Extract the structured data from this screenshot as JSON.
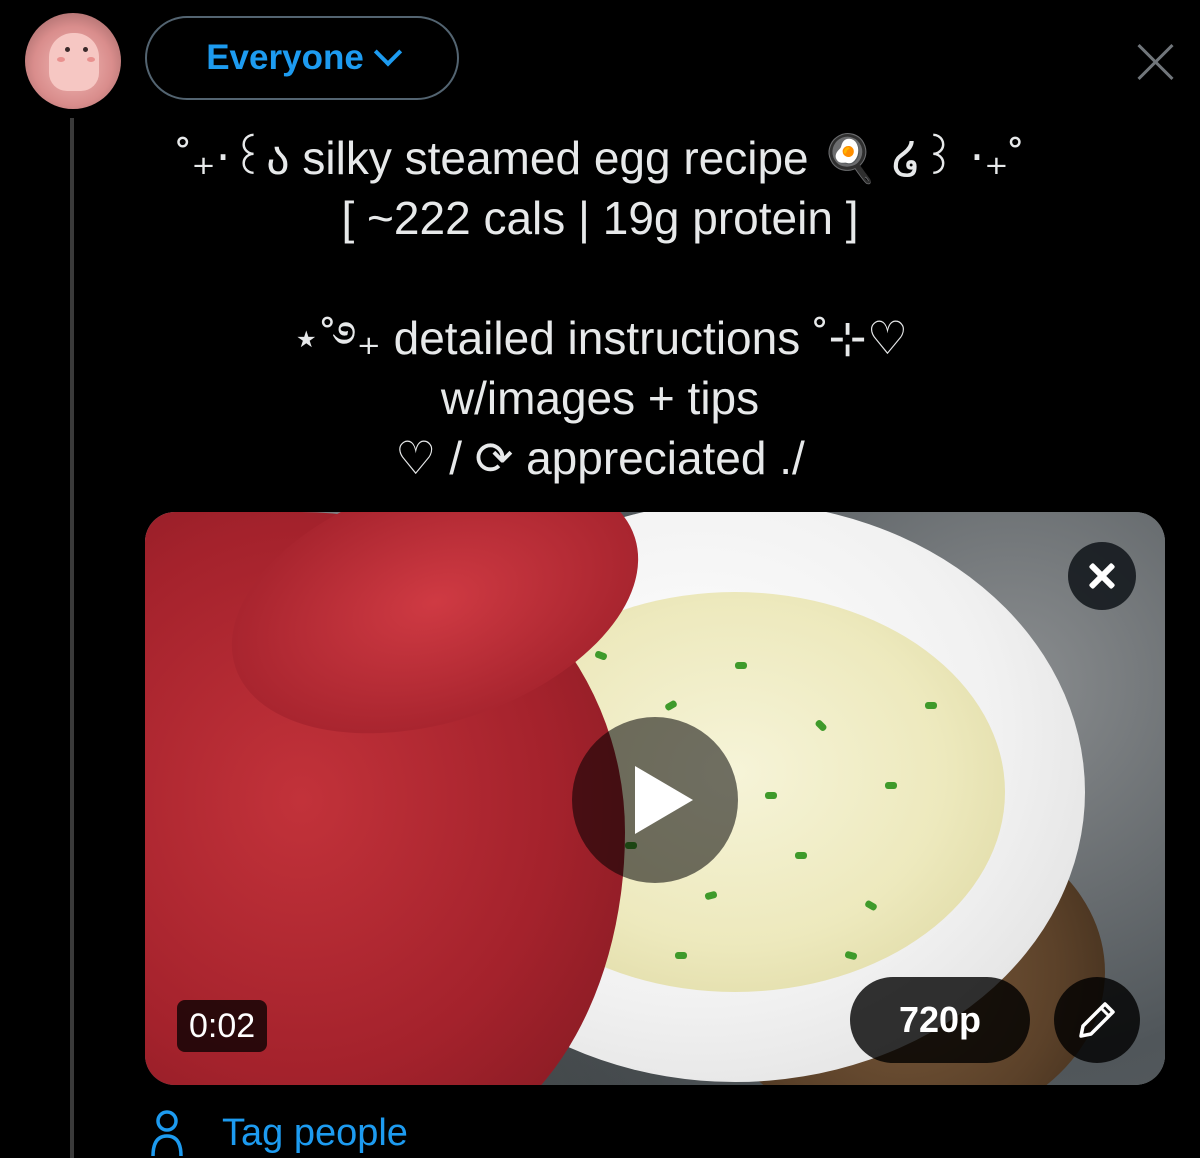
{
  "composer": {
    "audience_label": "Everyone",
    "post_text": "˚₊‧꒰ა silky steamed egg recipe 🍳 ໒꒱ ‧₊˚\n[ ~222 cals | 19g protein ]\n\n⋆˚࿔₊ detailed instructions ˚⊹♡\nw/images + tips\n♡ / ⟳ appreciated ./"
  },
  "video": {
    "timestamp": "0:02",
    "quality_label": "720p"
  },
  "footer": {
    "tag_people_label": "Tag people"
  },
  "colors": {
    "accent": "#1d9bf0",
    "background": "#000000",
    "text": "#e7e9ea"
  },
  "icons": [
    "chevron-down-icon",
    "close-icon",
    "play-icon",
    "remove-media-icon",
    "pencil-icon",
    "person-icon"
  ]
}
